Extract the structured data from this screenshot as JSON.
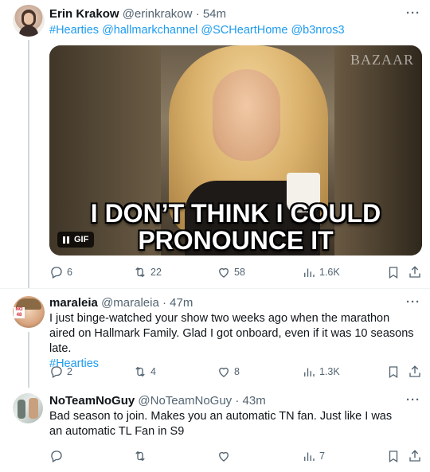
{
  "tweets": [
    {
      "author_name": "Erin Krakow",
      "handle": "@erinkrakow",
      "sep": "·",
      "time": "54m",
      "text_link": "#Hearties @hallmarkchannel @SCHeartHome @b3nros3",
      "media": {
        "brand": "BAZAAR",
        "caption_line1": "I DON’T THINK I COULD",
        "caption_line2": "PRONOUNCE IT",
        "badge": "GIF"
      },
      "stats": {
        "replies": "6",
        "reposts": "22",
        "likes": "58",
        "views": "1.6K"
      }
    },
    {
      "author_name": "maraleia",
      "handle": "@maraleia",
      "sep": "·",
      "time": "47m",
      "text": "I just binge-watched your show two weeks ago when the marathon aired on Hallmark Family. Glad I got onboard, even if it was 10 seasons late.",
      "text_link": "#Hearties",
      "avatar_badge": "NO 48",
      "stats": {
        "replies": "2",
        "reposts": "4",
        "likes": "8",
        "views": "1.3K"
      }
    },
    {
      "author_name": "NoTeamNoGuy",
      "handle": "@NoTeamNoGuy",
      "sep": "·",
      "time": "43m",
      "text": "Bad season to join. Makes you an automatic TN fan. Just like I was an automatic TL Fan in S9",
      "stats": {
        "replies": "",
        "reposts": "",
        "likes": "",
        "views": "7"
      }
    }
  ],
  "more_label": "···",
  "icons": {
    "reply": "reply-icon",
    "repost": "repost-icon",
    "like": "heart-icon",
    "views": "views-icon",
    "bookmark": "bookmark-icon",
    "share": "share-icon"
  },
  "colors": {
    "link": "#1d9bf0",
    "muted": "#536471",
    "text": "#0f1419"
  }
}
